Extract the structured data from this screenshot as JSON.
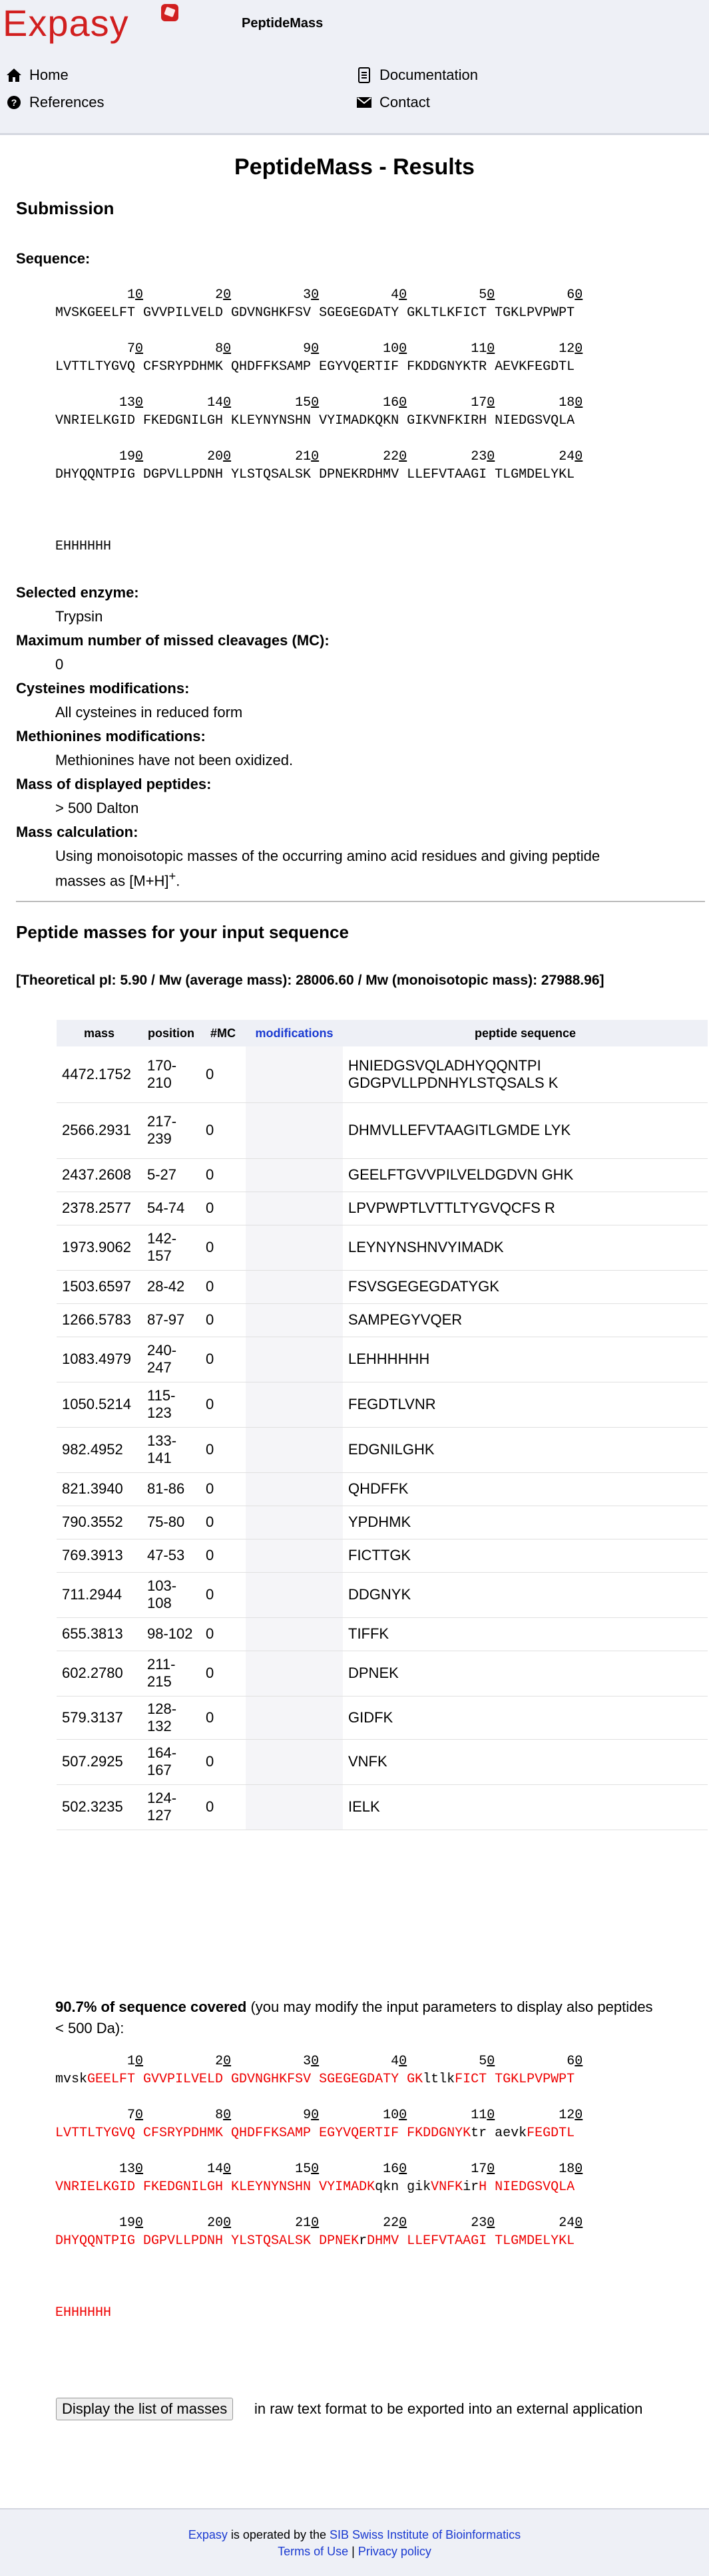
{
  "header": {
    "logo_text": "Expasy",
    "site_title": "PeptideMass",
    "nav": {
      "home": "Home",
      "references": "References",
      "documentation": "Documentation",
      "contact": "Contact"
    }
  },
  "page_title": "PeptideMass - Results",
  "submission": {
    "heading": "Submission",
    "sequence_label": "Sequence:",
    "sequence_block": "         10         20         30         40         50         60\nMVSKGEELFT GVVPILVELD GDVNGHKFSV SGEGEGDATY GKLTLKFICT TGKLPVPWPT\n\n         70         80         90        100        110        120\nLVTTLTYGVQ CFSRYPDHMK QHDFFKSAMP EGYVQERTIF FKDDGNYKTR AEVKFEGDTL\n\n        130        140        150        160        170        180\nVNRIELKGID FKEDGNILGH KLEYNYNSHN VYIMADKQKN GIKVNFKIRH NIEDGSVQLA\n\n        190        200        210        220        230        240\nDHYQQNTPIG DGPVLLPDNH YLSTQSALSK DPNEKRDHMV LLEFVTAAGI TLGMDELYKL\n\n\n\nEHHHHHH",
    "enzyme_label": "Selected enzyme:",
    "enzyme_value": "Trypsin",
    "mc_label": "Maximum number of missed cleavages (MC):",
    "mc_value": "0",
    "cys_label": "Cysteines modifications:",
    "cys_value": "All cysteines in reduced form",
    "met_label": "Methionines modifications:",
    "met_value": "Methionines have not been oxidized.",
    "mass_disp_label": "Mass of displayed peptides:",
    "mass_disp_value": "> 500 Dalton",
    "calc_label": "Mass calculation:",
    "calc_value_1": "Using monoisotopic masses of the occurring amino acid residues and giving peptide",
    "calc_value_2": "masses as [M+H]",
    "calc_sup": "+",
    "calc_end": "."
  },
  "results": {
    "heading": "Peptide masses for your input sequence",
    "theoretical": "[Theoretical pI: 5.90 / Mw (average mass): 28006.60 / Mw (monoisotopic mass): 27988.96]",
    "columns": {
      "mass": "mass",
      "position": "position",
      "mc": "#MC",
      "modifications": "modifications",
      "peptide": "peptide sequence"
    },
    "rows": [
      {
        "mass": "4472.1752",
        "position": "170-210",
        "mc": "0",
        "peptide": "HNIEDGSVQLADHYQQNTPI GDGPVLLPDNHYLSTQSALS K"
      },
      {
        "mass": "2566.2931",
        "position": "217-239",
        "mc": "0",
        "peptide": "DHMVLLEFVTAAGITLGMDE LYK"
      },
      {
        "mass": "2437.2608",
        "position": "5-27",
        "mc": "0",
        "peptide": "GEELFTGVVPILVELDGDVN GHK"
      },
      {
        "mass": "2378.2577",
        "position": "54-74",
        "mc": "0",
        "peptide": "LPVPWPTLVTTLTYGVQCFS R"
      },
      {
        "mass": "1973.9062",
        "position": "142-157",
        "mc": "0",
        "peptide": "LEYNYNSHNVYIMADK"
      },
      {
        "mass": "1503.6597",
        "position": "28-42",
        "mc": "0",
        "peptide": "FSVSGEGEGDATYGK"
      },
      {
        "mass": "1266.5783",
        "position": "87-97",
        "mc": "0",
        "peptide": "SAMPEGYVQER"
      },
      {
        "mass": "1083.4979",
        "position": "240-247",
        "mc": "0",
        "peptide": "LEHHHHHH"
      },
      {
        "mass": "1050.5214",
        "position": "115-123",
        "mc": "0",
        "peptide": "FEGDTLVNR"
      },
      {
        "mass": "982.4952",
        "position": "133-141",
        "mc": "0",
        "peptide": "EDGNILGHK"
      },
      {
        "mass": "821.3940",
        "position": "81-86",
        "mc": "0",
        "peptide": "QHDFFK"
      },
      {
        "mass": "790.3552",
        "position": "75-80",
        "mc": "0",
        "peptide": "YPDHMK"
      },
      {
        "mass": "769.3913",
        "position": "47-53",
        "mc": "0",
        "peptide": "FICTTGK"
      },
      {
        "mass": "711.2944",
        "position": "103-108",
        "mc": "0",
        "peptide": "DDGNYK"
      },
      {
        "mass": "655.3813",
        "position": "98-102",
        "mc": "0",
        "peptide": "TIFFK"
      },
      {
        "mass": "602.2780",
        "position": "211-215",
        "mc": "0",
        "peptide": "DPNEK"
      },
      {
        "mass": "579.3137",
        "position": "128-132",
        "mc": "0",
        "peptide": "GIDFK"
      },
      {
        "mass": "507.2925",
        "position": "164-167",
        "mc": "0",
        "peptide": "VNFK"
      },
      {
        "mass": "502.3235",
        "position": "124-127",
        "mc": "0",
        "peptide": "IELK"
      }
    ],
    "coverage_bold": "90.7% of sequence covered",
    "coverage_rest_1": " (you may modify the input parameters to display also peptides",
    "coverage_rest_2": "< 500 Da):",
    "coverage_sequence": [
      [
        [
          "n",
          "         10         20         30         40         50         60"
        ]
      ],
      [
        [
          "n",
          "mvsk"
        ],
        [
          "r",
          "GEELFT GVVPILVELD GDVNGHKFSV SGEGEGDATY GK"
        ],
        [
          "n",
          "ltlk"
        ],
        [
          "r",
          "FICT TGKLPVPWPT"
        ]
      ],
      [],
      [
        [
          "n",
          "         70         80         90        100        110        120"
        ]
      ],
      [
        [
          "r",
          "LVTTLTYGVQ CFSRYPDHMK QHDFFKSAMP EGYVQERTIF FKDDGNYK"
        ],
        [
          "n",
          "tr aevk"
        ],
        [
          "r",
          "FEGDTL"
        ]
      ],
      [],
      [
        [
          "n",
          "        130        140        150        160        170        180"
        ]
      ],
      [
        [
          "r",
          "VNRIELKGID FKEDGNILGH KLEYNYNSHN VYIMADK"
        ],
        [
          "n",
          "qkn gik"
        ],
        [
          "r",
          "VNFK"
        ],
        [
          "n",
          "ir"
        ],
        [
          "r",
          "H NIEDGSVQLA"
        ]
      ],
      [],
      [
        [
          "n",
          "        190        200        210        220        230        240"
        ]
      ],
      [
        [
          "r",
          "DHYQQNTPIG DGPVLLPDNH YLSTQSALSK DPNEK"
        ],
        [
          "n",
          "r"
        ],
        [
          "r",
          "DHMV LLEFVTAAGI TLGMDELYKL"
        ]
      ],
      [],
      [],
      [],
      [
        [
          "r",
          "EHHHHHH"
        ]
      ]
    ],
    "button_label": "Display the list of masses",
    "button_after": " in raw text format to be exported into an external application"
  },
  "footer": {
    "expasy": "Expasy",
    "operated": " is operated by the ",
    "sib": "SIB Swiss Institute of Bioinformatics",
    "terms": "Terms of Use",
    "sep": " | ",
    "privacy": "Privacy policy"
  }
}
